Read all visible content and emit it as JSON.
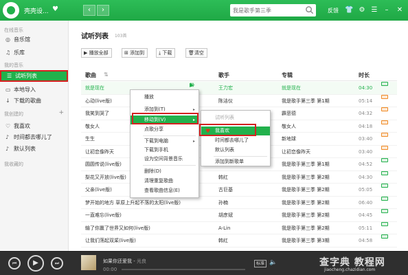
{
  "topbar": {
    "username": "壳壳设...",
    "vip_icon": "heart-diamond-icon",
    "search_placeholder": "我是歌手第三季",
    "feedback": "反馈",
    "back_glyph": "‹",
    "forward_glyph": "›",
    "icons": [
      "search-icon",
      "shirt-icon",
      "gear-icon",
      "menu-icon",
      "minimize-icon",
      "close-icon"
    ]
  },
  "sidebar": {
    "sections": [
      {
        "label": "在线音乐",
        "items": [
          {
            "label": "音乐馆",
            "icon": "music-hall-icon"
          },
          {
            "label": "乐库",
            "icon": "library-icon"
          }
        ]
      },
      {
        "label": "我的音乐",
        "items": [
          {
            "label": "试听列表",
            "icon": "list-icon",
            "active": true
          },
          {
            "label": "本地导入",
            "icon": "folder-icon"
          },
          {
            "label": "下载的歌曲",
            "icon": "download-icon"
          }
        ]
      },
      {
        "label": "我创建的",
        "items": [
          {
            "label": "我喜欢",
            "icon": "heart-icon"
          },
          {
            "label": "时间都去哪儿了",
            "icon": "playlist-icon"
          },
          {
            "label": "默认列表",
            "icon": "playlist-icon"
          }
        ]
      },
      {
        "label": "我收藏的",
        "items": []
      }
    ],
    "plus": "+"
  },
  "main": {
    "title": "试听列表",
    "count": "103首",
    "toolbar": [
      "播放全部",
      "添加到",
      "下载",
      "清空"
    ],
    "columns": {
      "title": "歌曲",
      "artist": "歌手",
      "album": "专辑",
      "time": "时长"
    },
    "rows": [
      {
        "title": "就是现在",
        "artist": "王力宏",
        "album": "就是现在",
        "time": "04:30",
        "badge": "green"
      },
      {
        "title": "心动(live版)",
        "artist": "陈洁仪",
        "album": "我是歌手第三季 第1期",
        "time": "05:14",
        "badge": "orange"
      },
      {
        "title": "我笑到哭了",
        "artist": "",
        "album": "霹恶德",
        "time": "04:32",
        "badge": "orange"
      },
      {
        "title": "敬女人",
        "artist": "",
        "album": "敬女人",
        "time": "04:18",
        "badge": "orange"
      },
      {
        "title": "生生",
        "artist": "",
        "album": "新地球",
        "time": "03:40",
        "badge": "orange"
      },
      {
        "title": "让初恋像昨天",
        "artist": "",
        "album": "让初恋像昨天",
        "time": "03:40",
        "badge": "orange"
      },
      {
        "title": "圆圆传说(live版)",
        "artist": "张靓颖",
        "album": "我是歌手第三季 第1期",
        "time": "04:52",
        "badge": "green"
      },
      {
        "title": "梨花又开放(live版)",
        "artist": "韩红",
        "album": "我是歌手第三季 第2期",
        "time": "04:30",
        "badge": "green"
      },
      {
        "title": "父亲(live版)",
        "artist": "古巨基",
        "album": "我是歌手第三季 第2期",
        "time": "05:05",
        "badge": "green"
      },
      {
        "title": "梦开始的地方  草原上升起不落的太阳(live版)",
        "artist": "孙楠",
        "album": "我是歌手第三季 第2期",
        "time": "06:40",
        "badge": "green"
      },
      {
        "title": "一直难忘(live版)",
        "artist": "胡彦斌",
        "album": "我是歌手第三季 第2期",
        "time": "04:45",
        "badge": "green"
      },
      {
        "title": "输了你赢了世界又如何(live版)",
        "artist": "A-Lin",
        "album": "我是歌手第三季 第2期",
        "time": "05:11",
        "badge": "green"
      },
      {
        "title": "让我们荡起双桨(live版)",
        "artist": "韩红",
        "album": "我是歌手第三季 第3期",
        "time": "04:58",
        "badge": "green"
      }
    ]
  },
  "context_menu": {
    "items": [
      {
        "label": "播放"
      },
      {
        "label": "添加到(T)",
        "arrow": "▸"
      },
      {
        "label": "移动到(V)",
        "arrow": "▸",
        "highlight": true
      },
      {
        "label": "点歌分享"
      },
      {
        "label": "下载到电脑",
        "arrow": "▸"
      },
      {
        "label": "下载到手机"
      },
      {
        "label": "设为空间背景音乐"
      },
      {
        "label": "删除(D)"
      },
      {
        "label": "清理重复歌曲"
      },
      {
        "label": "查看歌曲信息(E)"
      }
    ]
  },
  "submenu": {
    "items": [
      {
        "label": "试听列表",
        "disabled": true
      },
      {
        "label": "我喜欢",
        "highlight": true,
        "icon": "heart-icon"
      },
      {
        "label": "时间都去哪儿了"
      },
      {
        "label": "默认列表"
      },
      {
        "label": "添加到新歌单"
      }
    ]
  },
  "player": {
    "song": "如果你还爱我",
    "artist": "光良",
    "current_time": "00:00",
    "progress": 0,
    "quality": "标准",
    "buttons": [
      "prev-icon",
      "play-icon",
      "next-icon"
    ]
  },
  "watermark": {
    "text": "查字典 教程网",
    "url": "jiaocheng.chazidian.com"
  },
  "colors": {
    "brand": "#22b14c",
    "highlight_box": "#d62020",
    "badge_green": "#22b14c",
    "badge_orange": "#f08a24"
  }
}
